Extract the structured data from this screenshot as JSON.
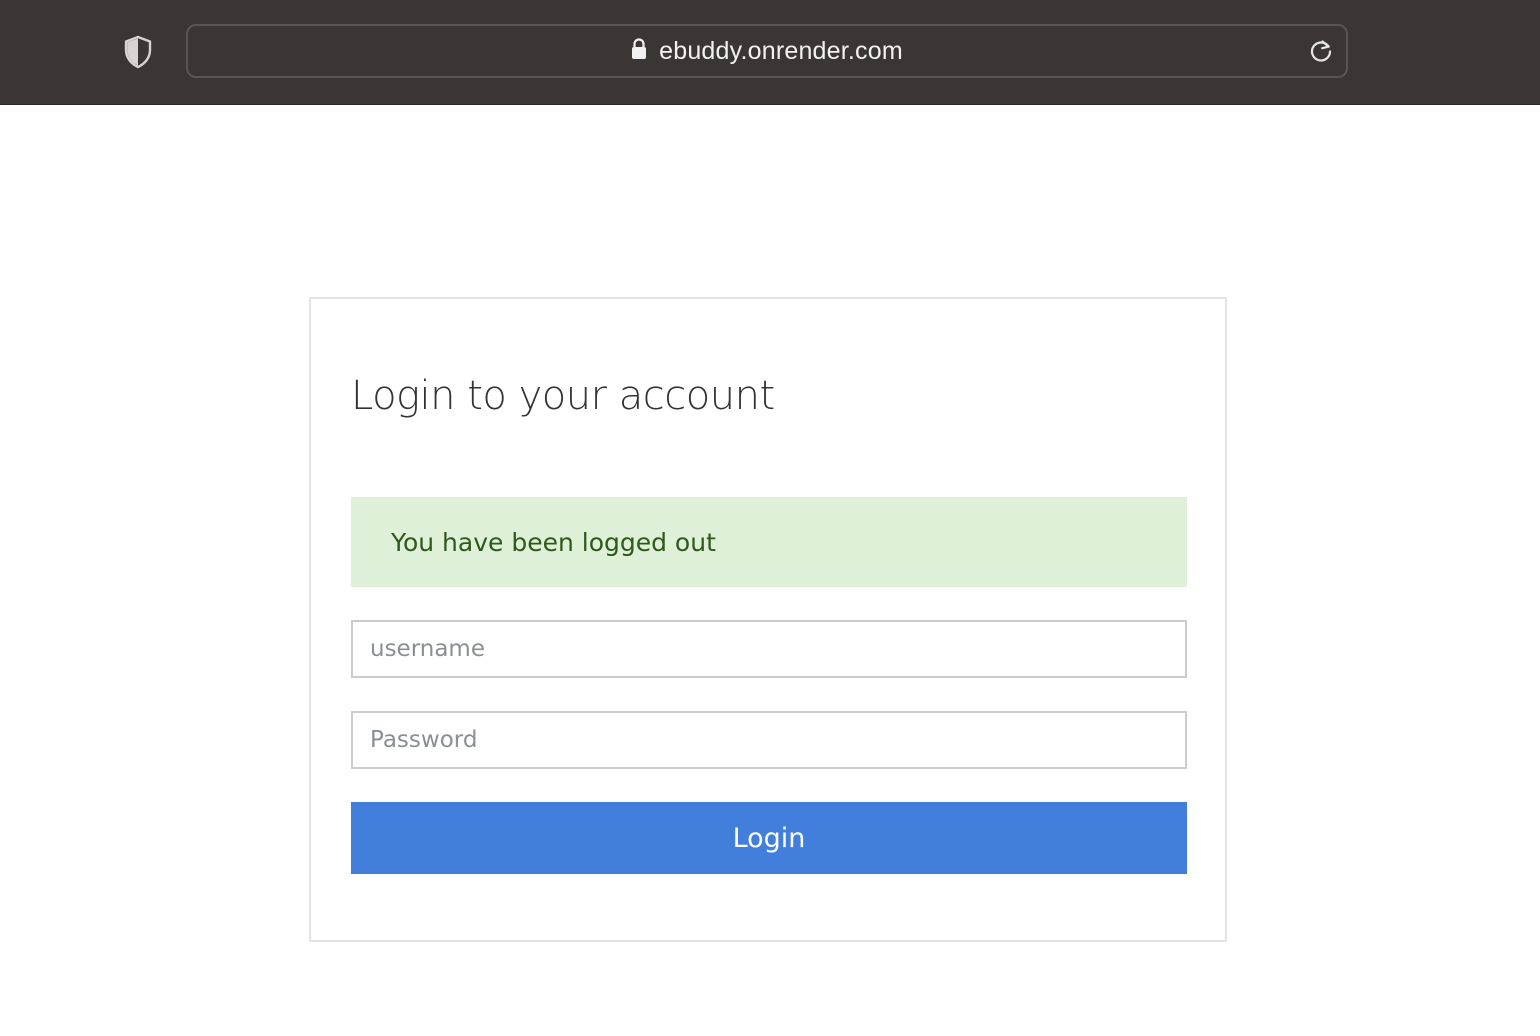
{
  "browser": {
    "url": "ebuddy.onrender.com",
    "icons": {
      "shield": "shield-icon",
      "lock": "lock-icon",
      "reload": "reload-icon"
    },
    "colors": {
      "toolbar_bg": "#3b3633"
    }
  },
  "login": {
    "title": "Login to your account",
    "alert": {
      "message": "You have been logged out",
      "bg_color": "#dff0d8",
      "text_color": "#2d5a1b"
    },
    "username": {
      "value": "",
      "placeholder": "username"
    },
    "password": {
      "value": "",
      "placeholder": "Password"
    },
    "submit_label": "Login",
    "colors": {
      "button": "#427fdd"
    }
  }
}
